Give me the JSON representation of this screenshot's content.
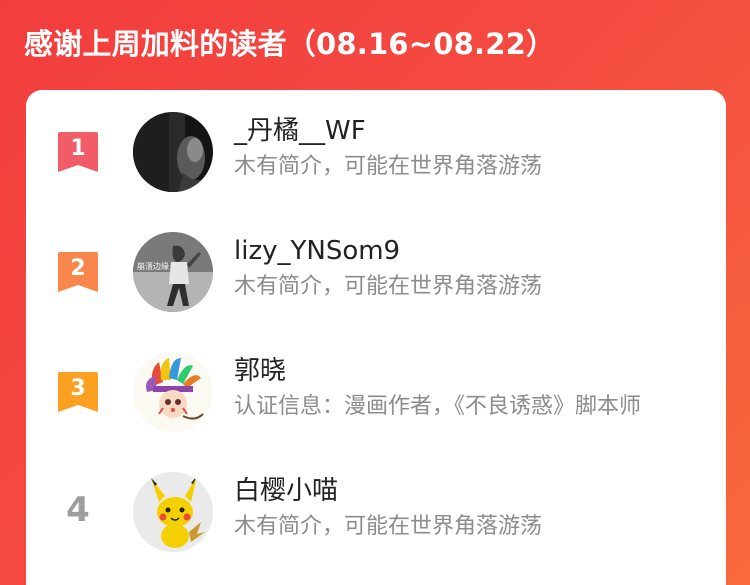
{
  "header": {
    "title": "感谢上周加料的读者（08.16~08.22）"
  },
  "colors": {
    "background_start": "#f23d3d",
    "background_end": "#f86a3c",
    "rank1": "#f25c66",
    "rank2": "#f9874d",
    "rank3": "#fba021",
    "rank_plain": "#9e9e9e",
    "name": "#222222",
    "desc": "#8c8c8c"
  },
  "readers": [
    {
      "rank": "1",
      "name": "_丹橘__WF",
      "description": "木有简介，可能在世界角落游荡",
      "avatar_icon": "dark-photo-avatar"
    },
    {
      "rank": "2",
      "name": "lizy_YNSom9",
      "description": "木有简介，可能在世界角落游荡",
      "avatar_icon": "dancer-photo-avatar",
      "avatar_text": "崩溃边缘"
    },
    {
      "rank": "3",
      "name": "郭晓",
      "description": "认证信息：漫画作者，《不良诱惑》脚本师",
      "avatar_icon": "feather-headdress-avatar"
    },
    {
      "rank": "4",
      "name": "白樱小喵",
      "description": "木有简介，可能在世界角落游荡",
      "avatar_icon": "pikachu-avatar"
    }
  ]
}
